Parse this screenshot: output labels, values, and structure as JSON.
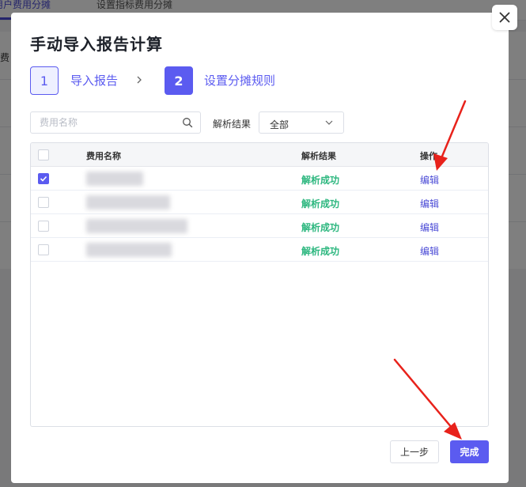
{
  "background": {
    "tabs": [
      "用户费用分摊",
      "设置指标费用分摊"
    ],
    "fragment": "费"
  },
  "modal": {
    "title": "手动导入报告计算",
    "close_icon": "close-icon",
    "steps": [
      {
        "num": "1",
        "label": "导入报告"
      },
      {
        "num": "2",
        "label": "设置分摊规则"
      }
    ],
    "search": {
      "placeholder": "费用名称",
      "value": ""
    },
    "filter": {
      "label": "解析结果",
      "selected": "全部"
    },
    "table": {
      "columns": {
        "name": "费用名称",
        "result": "解析结果",
        "op": "操作"
      },
      "rows": [
        {
          "result": "解析成功",
          "op": "编辑",
          "checked": true
        },
        {
          "result": "解析成功",
          "op": "编辑",
          "checked": false
        },
        {
          "result": "解析成功",
          "op": "编辑",
          "checked": false
        },
        {
          "result": "解析成功",
          "op": "编辑",
          "checked": false
        }
      ]
    },
    "buttons": {
      "prev": "上一步",
      "done": "完成"
    }
  },
  "colors": {
    "accent": "#5b5bf0",
    "success": "#2db77f",
    "link": "#4b4bd6",
    "annotation_arrow": "#e8221b"
  }
}
